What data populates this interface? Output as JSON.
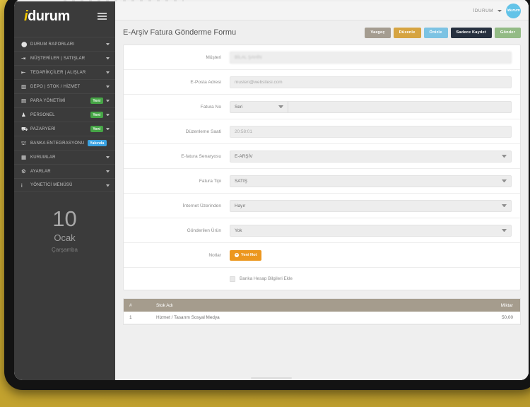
{
  "sidebar": {
    "brand": {
      "accent": "i",
      "rest": "durum"
    },
    "menu_icon": "hamburger-icon",
    "items": [
      {
        "icon": "⬤",
        "icon_name": "pie-chart-icon",
        "label": "DURUM RAPORLARI",
        "badge": null
      },
      {
        "icon": "⇥",
        "icon_name": "login-arrow-icon",
        "label": "MÜŞTERİLER | SATIŞLAR",
        "badge": null
      },
      {
        "icon": "⇤",
        "icon_name": "logout-arrow-icon",
        "label": "TEDARİKÇİLER | ALIŞLAR",
        "badge": null
      },
      {
        "icon": "▥",
        "icon_name": "warehouse-icon",
        "label": "DEPO | STOK / HİZMET",
        "badge": null
      },
      {
        "icon": "▤",
        "icon_name": "money-icon",
        "label": "PARA YÖNETİMİ",
        "badge": "Yeni",
        "badge_type": "new"
      },
      {
        "icon": "♟",
        "icon_name": "people-icon",
        "label": "PERSONEL",
        "badge": "Yeni",
        "badge_type": "new"
      },
      {
        "icon": "⛟",
        "icon_name": "cart-icon",
        "label": "PAZARYERİ",
        "badge": "Yeni",
        "badge_type": "new"
      },
      {
        "icon": "⛫",
        "icon_name": "bank-icon",
        "label": "BANKA ENTEGRASYONU",
        "badge": "Yakında",
        "badge_type": "soon"
      },
      {
        "icon": "▦",
        "icon_name": "institution-icon",
        "label": "KURUMLAR",
        "badge": null
      },
      {
        "icon": "⚙",
        "icon_name": "gear-icon",
        "label": "AYARLAR",
        "badge": null
      },
      {
        "icon": "i",
        "icon_name": "info-icon",
        "label": "YÖNETİCİ MENÜSÜ",
        "badge": null
      }
    ],
    "date": {
      "day": "10",
      "month": "Ocak",
      "weekday": "Çarşamba"
    }
  },
  "topbar": {
    "user_name": "İDURUM",
    "avatar_label": "idurum",
    "avatar_color": "#62c3e8"
  },
  "page": {
    "title": "E-Arşiv Fatura Gönderme Formu",
    "buttons": [
      {
        "label": "Vazgeç",
        "color": "#a49c90"
      },
      {
        "label": "Düzenle",
        "color": "#d6a441"
      },
      {
        "label": "Önizle",
        "color": "#7cc3e3"
      },
      {
        "label": "Sadece Kaydet",
        "color": "#26303f"
      },
      {
        "label": "Gönder",
        "color": "#93bb85"
      }
    ]
  },
  "form": {
    "rows": [
      {
        "label": "Müşteri",
        "type": "text-blurred",
        "value": "BİLAL ŞAHİN"
      },
      {
        "label": "E-Posta Adresi",
        "type": "text",
        "value": "musteri@websitesi.com"
      },
      {
        "label": "Fatura No",
        "type": "seri",
        "value": "Seri",
        "suffix_value": ""
      },
      {
        "label": "Düzenleme Saati",
        "type": "text",
        "value": "20:58:01"
      },
      {
        "label": "E-fatura Senaryosu",
        "type": "select",
        "value": "E-ARŞİV"
      },
      {
        "label": "Fatura Tipi",
        "type": "select",
        "value": "SATIŞ"
      },
      {
        "label": "İnternet Üzerinden",
        "type": "select",
        "value": "Hayır"
      },
      {
        "label": "Gönderilen Ürün",
        "type": "select",
        "value": "Yok"
      },
      {
        "label": "Notlar",
        "type": "button",
        "value": "Yeni Not"
      }
    ],
    "checkbox": {
      "label": "Banka Hesap Bilgileri Ekle",
      "checked": false
    }
  },
  "items_table": {
    "headers": {
      "index": "#",
      "name": "Stok Adı",
      "qty": "Miktar"
    },
    "rows": [
      {
        "index": "1",
        "name": "Hizmet / Tasarım Sosyal Medya",
        "qty": "50,00"
      }
    ]
  }
}
